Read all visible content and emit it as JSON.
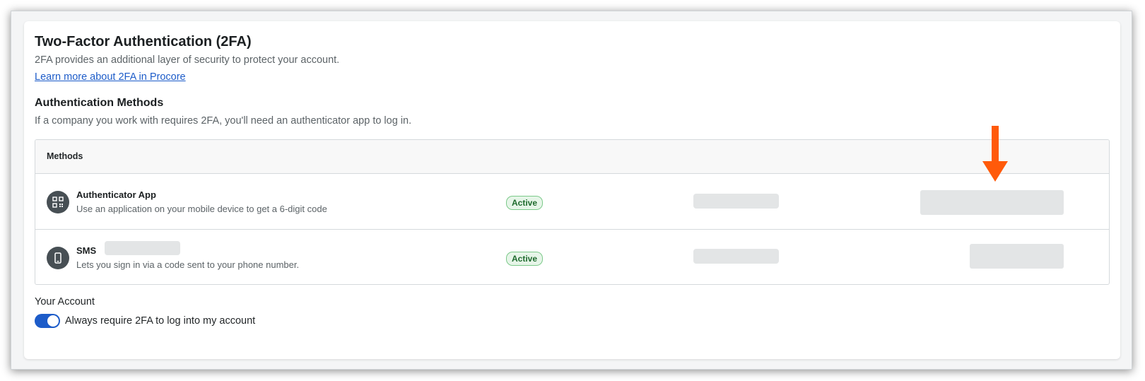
{
  "section": {
    "title": "Two-Factor Authentication (2FA)",
    "description": "2FA provides an additional layer of security to protect your account.",
    "learn_more_link": "Learn more about 2FA in Procore"
  },
  "methods_section": {
    "title": "Authentication Methods",
    "description": "If a company you work with requires 2FA, you'll need an authenticator app to log in."
  },
  "table": {
    "header": "Methods",
    "rows": [
      {
        "name": "Authenticator App",
        "description": "Use an application on your mobile device to get a 6-digit code",
        "status": "Active",
        "icon": "qr-code-icon"
      },
      {
        "name": "SMS",
        "description": "Lets you sign in via a code sent to your phone number.",
        "status": "Active",
        "icon": "phone-icon"
      }
    ]
  },
  "account": {
    "title": "Your Account",
    "toggle_label": "Always require 2FA to log into my account",
    "toggle_on": true
  },
  "colors": {
    "link": "#1d5cc9",
    "toggle": "#1d5cc9",
    "active_badge_bg": "#e6f5e8",
    "active_badge_text": "#1f6b2e",
    "annotation_arrow": "#ff5a0a"
  }
}
